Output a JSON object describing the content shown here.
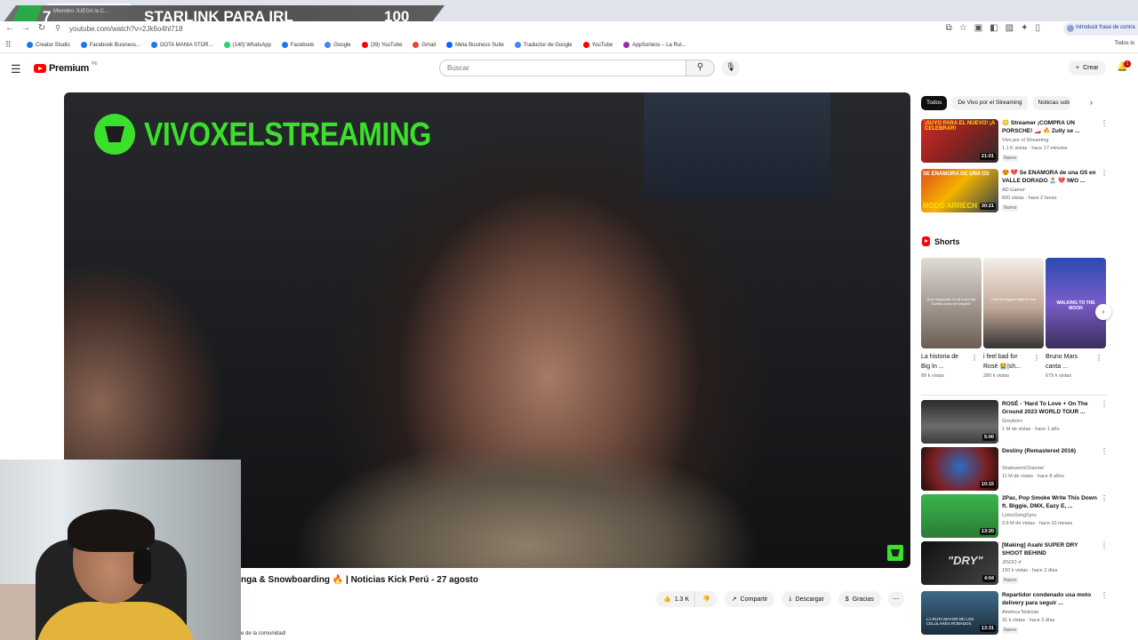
{
  "overlay_banner": {
    "number": "7",
    "tab_label": "Miembro JUEGA la C...",
    "title": "STARLINK PARA IRL",
    "value": "100"
  },
  "browser": {
    "url": "youtube.com/watch?v=2Jk6o4hl718",
    "profile_label": "Introducir frase de contra",
    "bookmarks": [
      {
        "label": "Creator Studio",
        "color": "#1877f2"
      },
      {
        "label": "Facebook Business...",
        "color": "#1877f2"
      },
      {
        "label": "DOTA MANIA STOR...",
        "color": "#1877f2"
      },
      {
        "label": "(140) WhatsApp",
        "color": "#25d366"
      },
      {
        "label": "Facebook",
        "color": "#1877f2"
      },
      {
        "label": "Google",
        "color": "#4285f4"
      },
      {
        "label": "(39) YouTube",
        "color": "#ff0000"
      },
      {
        "label": "Gmail",
        "color": "#ea4335"
      },
      {
        "label": "Meta Business Suite",
        "color": "#0866ff"
      },
      {
        "label": "Traductor de Google",
        "color": "#4285f4"
      },
      {
        "label": "YouTube",
        "color": "#ff0000"
      },
      {
        "label": "AppSorteos – La Rul...",
        "color": "#9c27b0"
      }
    ],
    "bookmarks_right": "Todos lo"
  },
  "youtube": {
    "logo_text": "Premium",
    "country": "PE",
    "search_placeholder": "Buscar",
    "create_label": "Crear",
    "notification_count": "1"
  },
  "player": {
    "watermark": "VIVOXELSTREAMING",
    "title": "nga & Snowboarding 🔥 | Noticias Kick Perú - 27 agosto",
    "community_text": "e de la comunidad!"
  },
  "actions": {
    "like_count": "1.3 K",
    "share": "Compartir",
    "download": "Descargar",
    "thanks": "Gracias"
  },
  "chips": [
    "Todos",
    "De Vivo por el Streaming",
    "Noticias sob"
  ],
  "recommended_top": [
    {
      "title": "😳 Streamer ¡COMPRA UN PORSCHE! 🏎️ 🔥 Zully se ...",
      "channel": "Vivo por el Streaming",
      "meta": "1.1 K vistas · hace 17 minutos",
      "badge": "Nuevo",
      "duration": "21:01",
      "thumb_text": "¡SUYO PARA EL NUEVO! ¡A CELEBRAR!"
    },
    {
      "title": "😍 💔 Se ENAMORA de una G5 en VALLE DORADO 🏝️ 💔 IWO ...",
      "channel": "AD Gamer",
      "meta": "600 vistas · hace 2 horas",
      "badge": "Nuevo",
      "duration": "30:21",
      "thumb_text": "SE ENAMORA DE UNA G5",
      "thumb_sub": "MODO ARRECH"
    }
  ],
  "shorts": {
    "heading": "Shorts",
    "items": [
      {
        "title": "La historia de Big In ...",
        "views": "89 k vistas",
        "thumb_text": "Al la respuesta \"si ud entra Mis Sueños para ser elegido\""
      },
      {
        "title": "i feel bad for Rosé 😭|sh...",
        "views": "280 k vistas",
        "thumb_text": "i feel the biggest fight for lisa"
      },
      {
        "title": "Bruno Mars canta ...",
        "views": "679 k vistas",
        "thumb_text": "WALKING TO THE MOON"
      }
    ]
  },
  "recommended_bottom": [
    {
      "title": "ROSÉ - 'Hard To Love + On The Ground 2023 WORLD TOUR ...",
      "channel": "Greyborn",
      "meta": "1 M de vistas · hace 1 año",
      "duration": "5:00"
    },
    {
      "title": "Destiny (Remastered 2016)",
      "channel": "ShatoverinChannel",
      "meta": "11 M de vistas · hace 8 años",
      "duration": "10:15"
    },
    {
      "title": "2Pac, Pop Smoke  Write This Down ft. Biggie, DMX, Eazy E, ...",
      "channel": "LyricsSongSync",
      "meta": "3.6 M de vistas · hace 10 meses",
      "duration": "13:20"
    },
    {
      "title": "[Making] Asahi SUPER DRY SHOOT BEHIND",
      "channel": "JISOO ✔",
      "meta": "150 k vistas · hace 2 días",
      "badge": "Nuevo",
      "duration": "4:04",
      "thumb_text": "\"DRY\""
    },
    {
      "title": "Repartidor condenado usa moto delivery para seguir ...",
      "channel": "América Noticias",
      "meta": "31 k vistas · hace 2 días",
      "badge": "Nuevo",
      "duration": "13:31",
      "thumb_text": "LA RUTA MAYOR DE LOS CELULARES ROBADOS"
    }
  ]
}
